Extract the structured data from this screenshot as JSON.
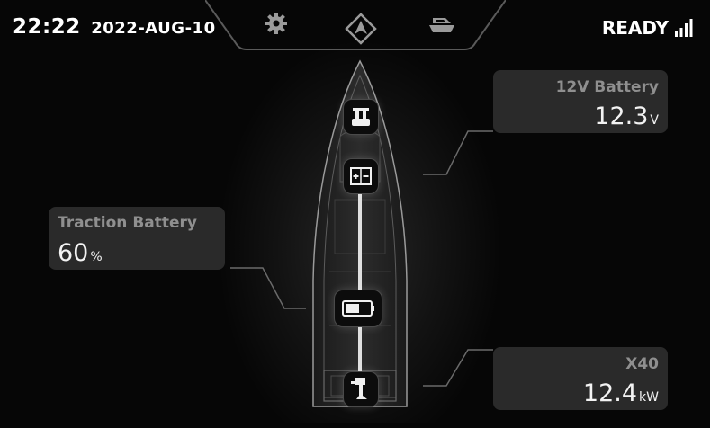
{
  "header": {
    "time": "22:22",
    "date": "2022-AUG-10",
    "status": "READY"
  },
  "nav": {
    "icons": [
      "settings-gear-icon",
      "navigation-arrow-icon",
      "boat-icon"
    ]
  },
  "cards": {
    "battery_12v": {
      "label": "12V Battery",
      "value": "12.3",
      "unit": "V"
    },
    "traction": {
      "label": "Traction Battery",
      "value": "60",
      "unit": "%"
    },
    "motor": {
      "label": "X40",
      "value": "12.4",
      "unit": "kW"
    }
  },
  "colors": {
    "background": "#060606",
    "card": "#2a2a2a",
    "label": "#8f8f8f",
    "value": "#f2f2f2"
  }
}
